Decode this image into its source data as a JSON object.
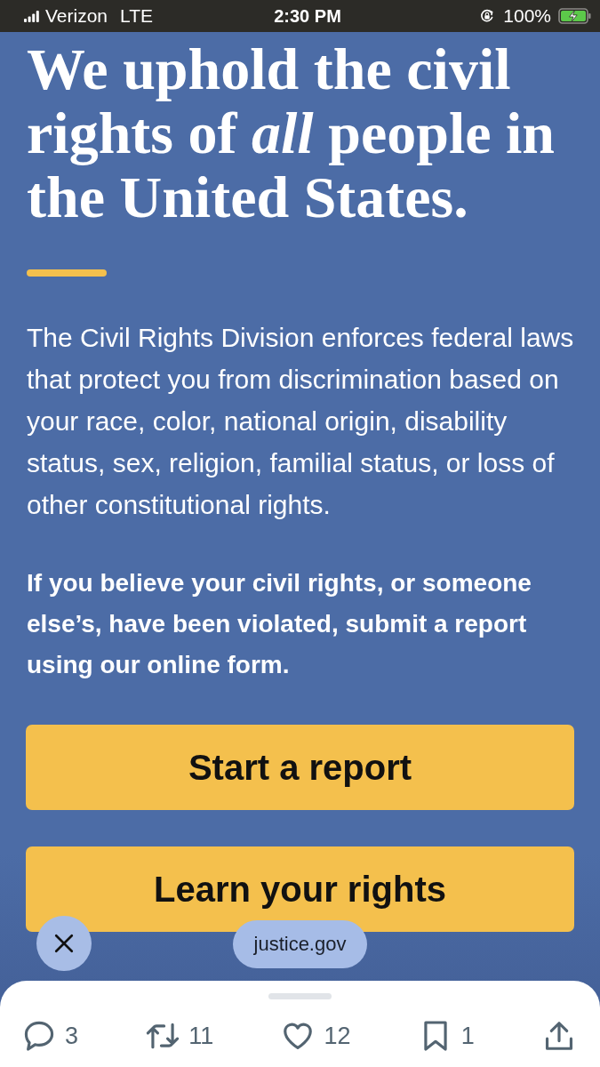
{
  "status_bar": {
    "carrier": "Verizon",
    "network": "LTE",
    "time": "2:30 PM",
    "rotation_lock": true,
    "battery": "100%",
    "charging": true
  },
  "page": {
    "headline": "We uphold the civil rights of *all* people in the United States.",
    "intro": "The Civil Rights Division enforces federal laws that protect you from discrimination based on your race, color, national origin, disability status, sex, religion, familial status, or loss of other constitutional rights.",
    "call_to_action": "If you believe your civil rights, or someone else’s, have been violated, submit a report using our online form.",
    "buttons": [
      {
        "label": "Start a report"
      },
      {
        "label": "Learn your rights"
      }
    ]
  },
  "browser_overlay": {
    "domain": "justice.gov"
  },
  "actions": [
    {
      "kind": "reply",
      "count": "3"
    },
    {
      "kind": "repost",
      "count": "11"
    },
    {
      "kind": "like",
      "count": "12"
    },
    {
      "kind": "bookmark",
      "count": "1"
    },
    {
      "kind": "share"
    }
  ]
}
